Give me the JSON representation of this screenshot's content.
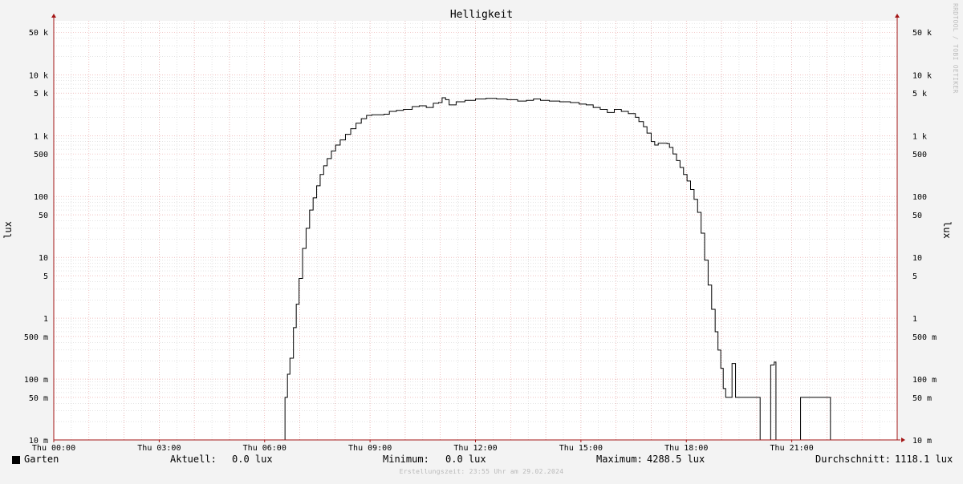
{
  "title": "Helligkeit",
  "watermark": "RRDTOOL / TOBI OETIKER",
  "footer": "Erstellungszeit: 23:55 Uhr am 29.02.2024",
  "legend": {
    "series_name": "Garten",
    "current_label": "Aktuell:",
    "current_value": "0.0 lux",
    "min_label": "Minimum:",
    "min_value": "0.0 lux",
    "max_label": "Maximum:",
    "max_value": "4288.5 lux",
    "avg_label": "Durchschnitt:",
    "avg_value": "1118.1 lux"
  },
  "colors": {
    "background": "#f3f3f3",
    "plot": "#ffffff",
    "line": "#000000",
    "major_grid": "#e79a9a",
    "minor_grid": "#c8c8c8",
    "axis": "#a31515"
  },
  "chart_data": {
    "type": "line",
    "title": "Helligkeit",
    "ylabel": "lux",
    "ylabel_right": "lux",
    "yscale": "log",
    "ylim": [
      0.01,
      70000
    ],
    "xlim": [
      0,
      24
    ],
    "x_unit": "hours",
    "grid": true,
    "x_ticks": [
      {
        "v": 0,
        "label": "Thu 00:00"
      },
      {
        "v": 3,
        "label": "Thu 03:00"
      },
      {
        "v": 6,
        "label": "Thu 06:00"
      },
      {
        "v": 9,
        "label": "Thu 09:00"
      },
      {
        "v": 12,
        "label": "Thu 12:00"
      },
      {
        "v": 15,
        "label": "Thu 15:00"
      },
      {
        "v": 18,
        "label": "Thu 18:00"
      },
      {
        "v": 21,
        "label": "Thu 21:00"
      }
    ],
    "y_ticks": [
      {
        "v": 0.01,
        "label": "10 m"
      },
      {
        "v": 0.05,
        "label": "50 m"
      },
      {
        "v": 0.1,
        "label": "100 m"
      },
      {
        "v": 0.5,
        "label": "500 m"
      },
      {
        "v": 1,
        "label": "1"
      },
      {
        "v": 5,
        "label": "5"
      },
      {
        "v": 10,
        "label": "10"
      },
      {
        "v": 50,
        "label": "50"
      },
      {
        "v": 100,
        "label": "100"
      },
      {
        "v": 500,
        "label": "500"
      },
      {
        "v": 1000,
        "label": "1 k"
      },
      {
        "v": 5000,
        "label": "5 k"
      },
      {
        "v": 10000,
        "label": "10 k"
      },
      {
        "v": 50000,
        "label": "50 k"
      }
    ],
    "series": [
      {
        "name": "Garten",
        "color": "#000000",
        "points": [
          [
            0.0,
            0.01
          ],
          [
            6.55,
            0.01
          ],
          [
            6.58,
            0.05
          ],
          [
            6.65,
            0.12
          ],
          [
            6.72,
            0.22
          ],
          [
            6.82,
            0.7
          ],
          [
            6.9,
            1.7
          ],
          [
            6.98,
            4.5
          ],
          [
            7.08,
            14
          ],
          [
            7.18,
            30
          ],
          [
            7.28,
            60
          ],
          [
            7.38,
            95
          ],
          [
            7.48,
            150
          ],
          [
            7.58,
            230
          ],
          [
            7.68,
            320
          ],
          [
            7.78,
            420
          ],
          [
            7.9,
            560
          ],
          [
            8.02,
            700
          ],
          [
            8.15,
            850
          ],
          [
            8.3,
            1050
          ],
          [
            8.45,
            1300
          ],
          [
            8.6,
            1600
          ],
          [
            8.75,
            1900
          ],
          [
            8.9,
            2150
          ],
          [
            9.05,
            2200
          ],
          [
            9.25,
            2200
          ],
          [
            9.4,
            2250
          ],
          [
            9.55,
            2500
          ],
          [
            9.75,
            2600
          ],
          [
            9.95,
            2700
          ],
          [
            10.2,
            3000
          ],
          [
            10.4,
            3100
          ],
          [
            10.6,
            2900
          ],
          [
            10.8,
            3400
          ],
          [
            10.95,
            3500
          ],
          [
            11.05,
            4200
          ],
          [
            11.15,
            3900
          ],
          [
            11.25,
            3200
          ],
          [
            11.45,
            3600
          ],
          [
            11.7,
            3800
          ],
          [
            12.0,
            4000
          ],
          [
            12.3,
            4100
          ],
          [
            12.6,
            4000
          ],
          [
            12.9,
            3900
          ],
          [
            13.2,
            3700
          ],
          [
            13.45,
            3800
          ],
          [
            13.65,
            4000
          ],
          [
            13.85,
            3800
          ],
          [
            14.1,
            3700
          ],
          [
            14.4,
            3600
          ],
          [
            14.7,
            3500
          ],
          [
            14.95,
            3300
          ],
          [
            15.15,
            3200
          ],
          [
            15.35,
            2900
          ],
          [
            15.55,
            2700
          ],
          [
            15.75,
            2400
          ],
          [
            15.95,
            2700
          ],
          [
            16.15,
            2500
          ],
          [
            16.35,
            2300
          ],
          [
            16.55,
            2000
          ],
          [
            16.65,
            1700
          ],
          [
            16.78,
            1400
          ],
          [
            16.88,
            1100
          ],
          [
            17.0,
            800
          ],
          [
            17.1,
            700
          ],
          [
            17.2,
            750
          ],
          [
            17.45,
            740
          ],
          [
            17.52,
            640
          ],
          [
            17.62,
            500
          ],
          [
            17.72,
            390
          ],
          [
            17.82,
            300
          ],
          [
            17.92,
            230
          ],
          [
            18.02,
            180
          ],
          [
            18.12,
            130
          ],
          [
            18.22,
            90
          ],
          [
            18.32,
            55
          ],
          [
            18.42,
            25
          ],
          [
            18.52,
            9
          ],
          [
            18.62,
            3.5
          ],
          [
            18.72,
            1.4
          ],
          [
            18.82,
            0.6
          ],
          [
            18.9,
            0.3
          ],
          [
            18.98,
            0.15
          ],
          [
            19.05,
            0.07
          ],
          [
            19.12,
            0.05
          ],
          [
            19.28,
            0.05
          ],
          [
            19.3,
            0.18
          ],
          [
            19.35,
            0.18
          ],
          [
            19.4,
            0.05
          ],
          [
            20.05,
            0.05
          ],
          [
            20.1,
            0.01
          ],
          [
            20.35,
            0.01
          ],
          [
            20.4,
            0.17
          ],
          [
            20.5,
            0.19
          ],
          [
            20.55,
            0.01
          ],
          [
            21.2,
            0.01
          ],
          [
            21.25,
            0.05
          ],
          [
            22.05,
            0.05
          ],
          [
            22.1,
            0.01
          ],
          [
            24.0,
            0.01
          ]
        ]
      }
    ]
  }
}
